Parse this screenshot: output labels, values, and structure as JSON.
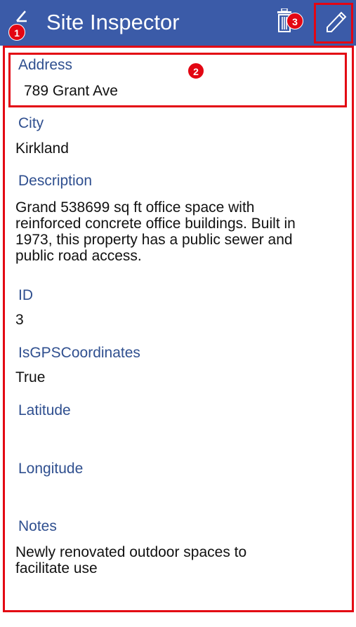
{
  "header": {
    "title": "Site Inspector",
    "background_color": "#3b5ba8",
    "back_icon": "back-arrow-icon",
    "delete_icon": "trash-icon",
    "edit_icon": "pencil-icon"
  },
  "annotations": {
    "color": "#e30613",
    "badges": [
      "1",
      "2",
      "3"
    ]
  },
  "fields": {
    "address": {
      "label": "Address",
      "value": "789 Grant Ave"
    },
    "city": {
      "label": "City",
      "value": "Kirkland"
    },
    "description": {
      "label": "Description",
      "value": "Grand 538699 sq ft office space with reinforced concrete office buildings. Built in 1973, this property has a public sewer and public road access."
    },
    "id": {
      "label": "ID",
      "value": "3"
    },
    "is_gps": {
      "label": "IsGPSCoordinates",
      "value": "True"
    },
    "latitude": {
      "label": "Latitude",
      "value": ""
    },
    "longitude": {
      "label": "Longitude",
      "value": ""
    },
    "notes": {
      "label": "Notes",
      "value": "Newly renovated outdoor spaces to facilitate use"
    }
  }
}
